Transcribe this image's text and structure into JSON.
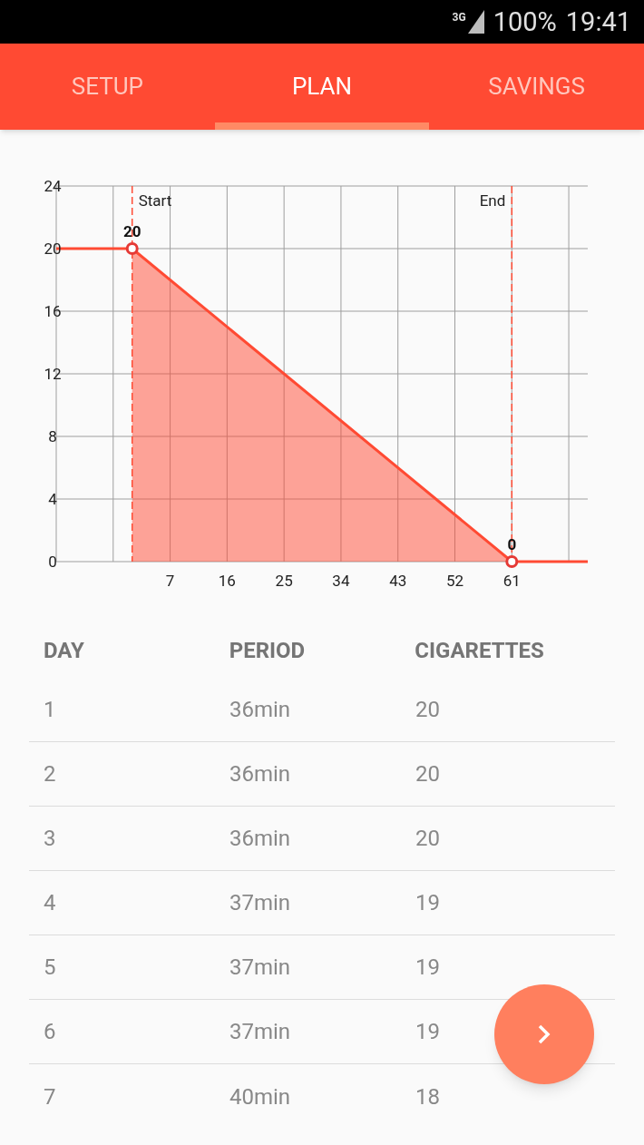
{
  "status_bar": {
    "network": "3G",
    "battery": "100%",
    "time": "19:41"
  },
  "tabs": [
    {
      "label": "SETUP",
      "selected": false
    },
    {
      "label": "PLAN",
      "selected": true
    },
    {
      "label": "SAVINGS",
      "selected": false
    }
  ],
  "chart": {
    "chart_data": {
      "type": "area",
      "x": [
        -11,
        1,
        61,
        73
      ],
      "series": [
        {
          "type": "line",
          "color": "#ff4a33",
          "values": [
            20,
            20,
            0,
            0
          ]
        },
        {
          "type": "area",
          "color": "#ff4a33",
          "values": [
            null,
            20,
            0,
            null
          ]
        }
      ],
      "xlim": [
        -11,
        73
      ],
      "ylim": [
        0,
        24
      ],
      "xticks": [
        7,
        16,
        25,
        34,
        43,
        52,
        61
      ],
      "yticks": [
        0,
        4,
        8,
        12,
        16,
        20,
        24
      ],
      "grid": true,
      "value_labels": [
        null,
        "20",
        "0",
        null
      ],
      "ref_lines": [
        {
          "axis": "x",
          "value": 1,
          "label": "Start"
        },
        {
          "axis": "x",
          "value": 61,
          "label": "End"
        }
      ]
    }
  },
  "table": {
    "columns": [
      "DAY",
      "PERIOD",
      "CIGARETTES"
    ],
    "rows": [
      [
        "1",
        "36min",
        "20"
      ],
      [
        "2",
        "36min",
        "20"
      ],
      [
        "3",
        "36min",
        "20"
      ],
      [
        "4",
        "37min",
        "19"
      ],
      [
        "5",
        "37min",
        "19"
      ],
      [
        "6",
        "37min",
        "19"
      ],
      [
        "7",
        "40min",
        "18"
      ]
    ]
  }
}
